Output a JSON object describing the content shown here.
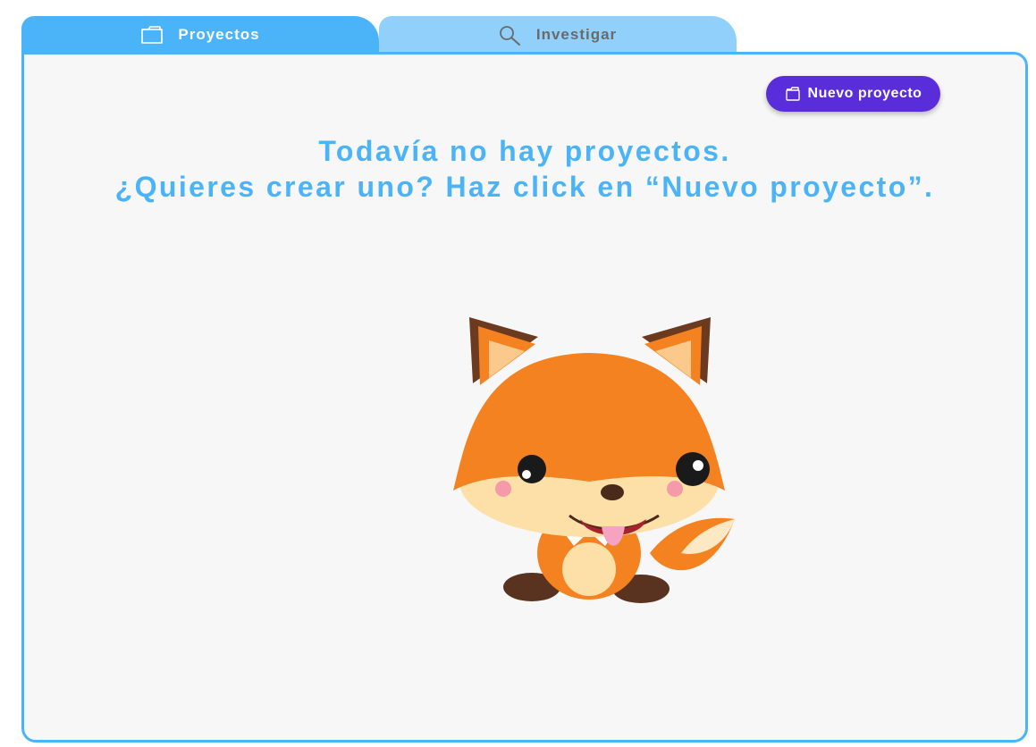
{
  "tabs": [
    {
      "label": "Proyectos",
      "icon": "folder-icon",
      "active": true
    },
    {
      "label": "Investigar",
      "icon": "search-icon",
      "active": false
    }
  ],
  "toolbar": {
    "new_project_label": "Nuevo proyecto",
    "new_project_icon": "folder-icon"
  },
  "empty_state": {
    "line1": "Todavía no hay proyectos.",
    "line2": "¿Quieres crear uno? Haz click en “Nuevo proyecto”.",
    "illustration": "fox-mascot"
  },
  "colors": {
    "accent": "#4bb4f8",
    "tab_inactive": "#90d0fb",
    "button": "#5a2ddb",
    "panel_bg": "#f7f7f7"
  }
}
